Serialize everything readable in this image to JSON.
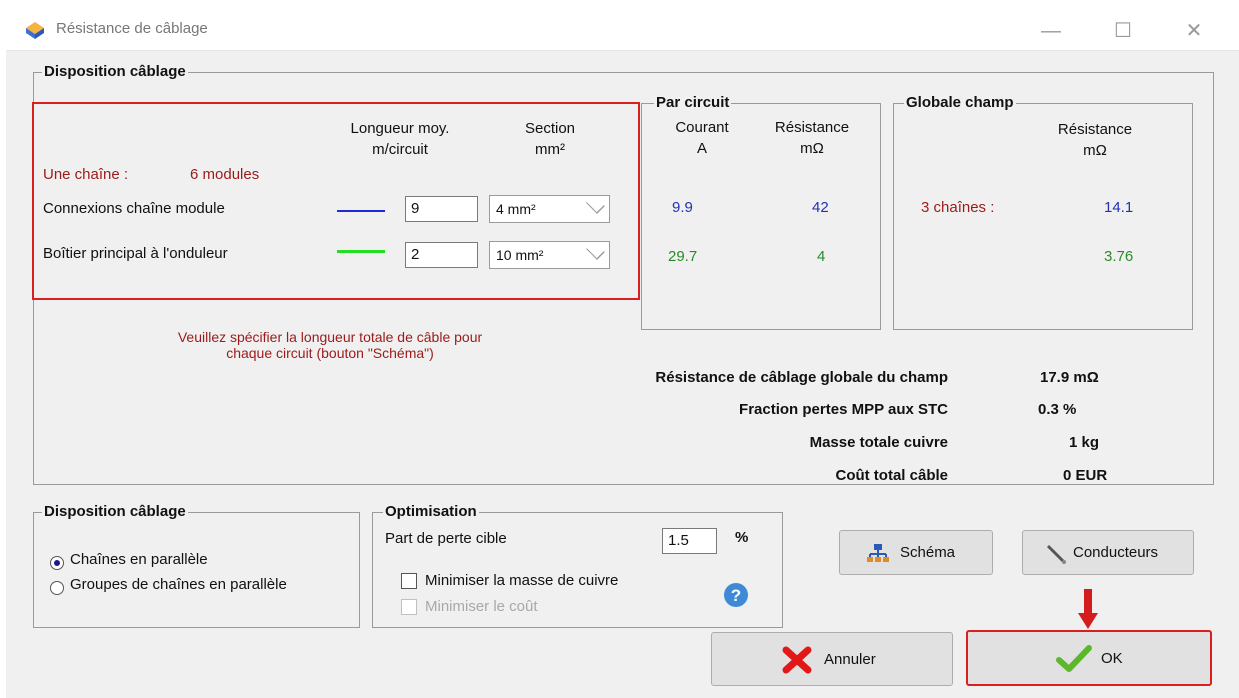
{
  "window": {
    "title": "Résistance de câblage",
    "minimize_glyph": "—",
    "maximize_glyph": "☐",
    "close_glyph": "✕"
  },
  "main_group": {
    "title": "Disposition câblage",
    "col_length_line1": "Longueur moy.",
    "col_length_line2": "m/circuit",
    "col_section_line1": "Section",
    "col_section_line2": "mm²",
    "chain_label": "Une chaîne :",
    "chain_value": "6 modules",
    "rows": [
      {
        "label": "Connexions chaîne module",
        "line_color": "#1f2bd6",
        "length": "9",
        "section": "4 mm²"
      },
      {
        "label": "Boîtier principal à l'onduleur",
        "line_color": "#22dd22",
        "length": "2",
        "section": "10 mm²"
      }
    ],
    "note_line1": "Veuillez spécifier la longueur totale de câble pour",
    "note_line2": "chaque circuit (bouton \"Schéma\")"
  },
  "par_circuit": {
    "title": "Par circuit",
    "col_current_line1": "Courant",
    "col_current_line2": "A",
    "col_res_line1": "Résistance",
    "col_res_line2": "mΩ",
    "rows": [
      {
        "current": "9.9",
        "resistance": "42"
      },
      {
        "current": "29.7",
        "resistance": "4"
      }
    ]
  },
  "globale": {
    "title": "Globale champ",
    "col_res_line1": "Résistance",
    "col_res_line2": "mΩ",
    "chains_label": "3 chaînes :",
    "values": [
      "14.1",
      "3.76"
    ]
  },
  "summary": [
    {
      "label": "Résistance de câblage globale du champ",
      "value": "17.9 mΩ"
    },
    {
      "label": "Fraction pertes MPP aux STC",
      "value": "0.3 %"
    },
    {
      "label": "Masse totale cuivre",
      "value": "1 kg"
    },
    {
      "label": "Coût total câble",
      "value": "0 EUR"
    }
  ],
  "layout_group": {
    "title": "Disposition câblage",
    "options": [
      "Chaînes en parallèle",
      "Groupes de chaînes en parallèle"
    ],
    "selected": 0
  },
  "optimisation": {
    "title": "Optimisation",
    "target_label": "Part de perte cible",
    "target_value": "1.5",
    "target_unit": "%",
    "check1": "Minimiser la masse de cuivre",
    "check2": "Minimiser le coût"
  },
  "buttons": {
    "schema": "Schéma",
    "conductors": "Conducteurs",
    "cancel": "Annuler",
    "ok": "OK"
  },
  "colors": {
    "accent_red": "#d92020",
    "blue_value": "#2231b5",
    "green_value": "#2a8a2a",
    "dark_red_text": "#9b1b1b"
  }
}
